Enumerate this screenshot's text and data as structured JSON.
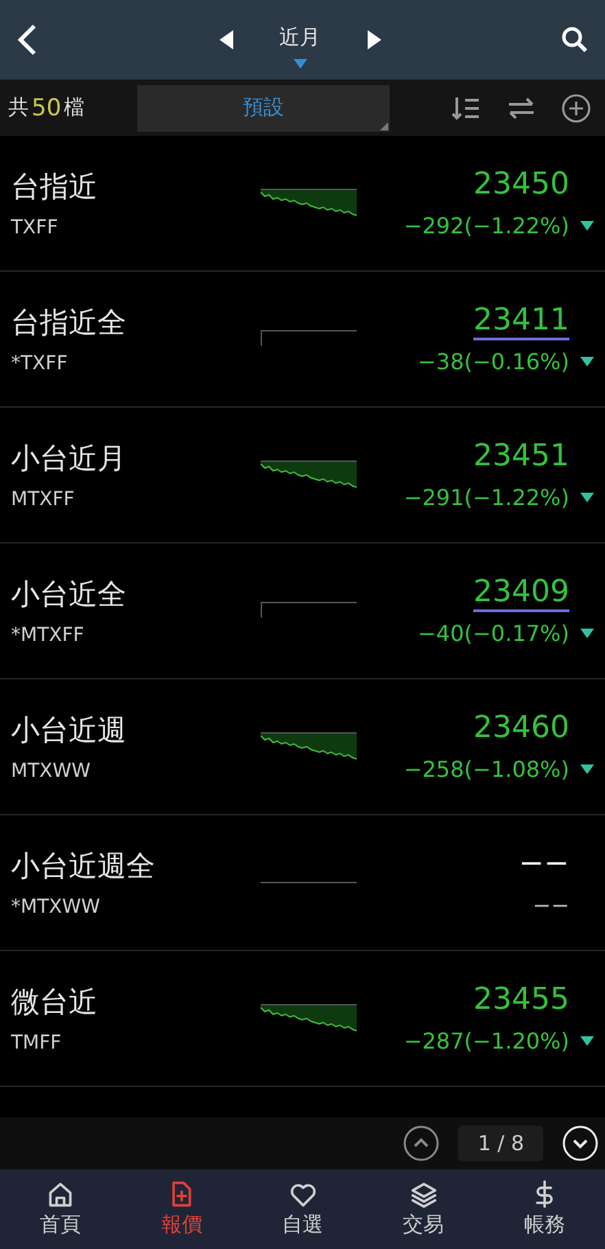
{
  "header": {
    "title": "近月"
  },
  "toolbar": {
    "count_prefix": "共",
    "count": "50",
    "count_suffix": "檔",
    "preset": "預設"
  },
  "rows": [
    {
      "kind": "area",
      "name": "台指近",
      "code": "TXFF",
      "price": "23450",
      "change": "−292(−1.22%)",
      "falling": true,
      "underlined": false
    },
    {
      "kind": "flat",
      "name": "台指近全",
      "code": "*TXFF",
      "price": "23411",
      "change": "−38(−0.16%)",
      "falling": true,
      "underlined": true
    },
    {
      "kind": "area",
      "name": "小台近月",
      "code": "MTXFF",
      "price": "23451",
      "change": "−291(−1.22%)",
      "falling": true,
      "underlined": false
    },
    {
      "kind": "flat",
      "name": "小台近全",
      "code": "*MTXFF",
      "price": "23409",
      "change": "−40(−0.17%)",
      "falling": true,
      "underlined": true
    },
    {
      "kind": "area",
      "name": "小台近週",
      "code": "MTXWW",
      "price": "23460",
      "change": "−258(−1.08%)",
      "falling": true,
      "underlined": false
    },
    {
      "kind": "empty",
      "name": "小台近週全",
      "code": "*MTXWW",
      "price": "−−",
      "change": "−−",
      "falling": false,
      "underlined": false
    },
    {
      "kind": "area",
      "name": "微台近",
      "code": "TMFF",
      "price": "23455",
      "change": "−287(−1.20%)",
      "falling": true,
      "underlined": false
    }
  ],
  "pager": {
    "page": "1 / 8"
  },
  "nav": [
    {
      "label": "首頁",
      "selected": false
    },
    {
      "label": "報價",
      "selected": true
    },
    {
      "label": "自選",
      "selected": false
    },
    {
      "label": "交易",
      "selected": false
    },
    {
      "label": "帳務",
      "selected": false
    }
  ]
}
